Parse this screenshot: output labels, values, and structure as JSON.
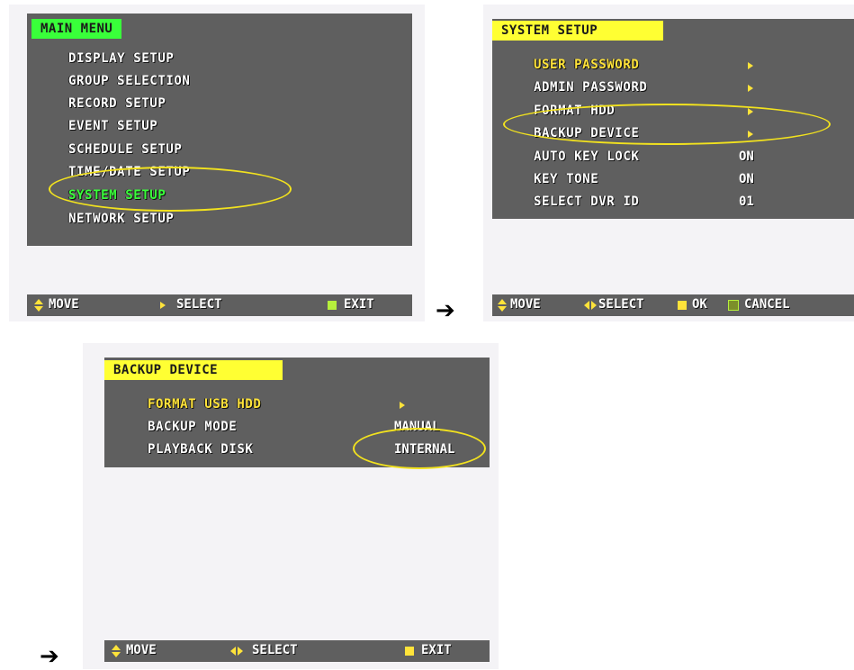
{
  "colors": {
    "menu_bg": "#5f5f5f",
    "title_bg_green": "#39ff3a",
    "title_bg_yellow": "#ffff33",
    "highlight_yellow": "#ffe33a",
    "highlight_green": "#39ff3a",
    "annotation_ellipse": "#f2e21e"
  },
  "flow_arrow": "➔",
  "main_menu": {
    "title": "MAIN MENU",
    "items": [
      {
        "label": "DISPLAY SETUP"
      },
      {
        "label": "GROUP SELECTION"
      },
      {
        "label": "RECORD SETUP"
      },
      {
        "label": "EVENT SETUP"
      },
      {
        "label": "SCHEDULE SETUP"
      },
      {
        "label": "TIME/DATE SETUP"
      },
      {
        "label": "SYSTEM SETUP",
        "selected": true
      },
      {
        "label": "NETWORK SETUP"
      }
    ],
    "status": {
      "move": "MOVE",
      "select": "SELECT",
      "exit": "EXIT"
    }
  },
  "system_setup": {
    "title": "SYSTEM SETUP",
    "items": [
      {
        "label": "USER PASSWORD",
        "value": "▸",
        "selected": true
      },
      {
        "label": "ADMIN PASSWORD",
        "value": "▸"
      },
      {
        "label": "FORMAT HDD",
        "value": "▸"
      },
      {
        "label": "BACKUP DEVICE",
        "value": "▸"
      },
      {
        "label": "AUTO KEY LOCK",
        "value": "ON"
      },
      {
        "label": "KEY TONE",
        "value": "ON"
      },
      {
        "label": "SELECT DVR ID",
        "value": "01"
      }
    ],
    "status": {
      "move": "MOVE",
      "select": "SELECT",
      "ok": "OK",
      "cancel": "CANCEL"
    }
  },
  "backup_device": {
    "title": "BACKUP DEVICE",
    "items": [
      {
        "label": "FORMAT USB HDD",
        "value": "▸",
        "selected": true
      },
      {
        "label": "BACKUP MODE",
        "value": "MANUAL"
      },
      {
        "label": "PLAYBACK DISK",
        "value": "INTERNAL"
      }
    ],
    "status": {
      "move": "MOVE",
      "select": "SELECT",
      "exit": "EXIT"
    }
  }
}
